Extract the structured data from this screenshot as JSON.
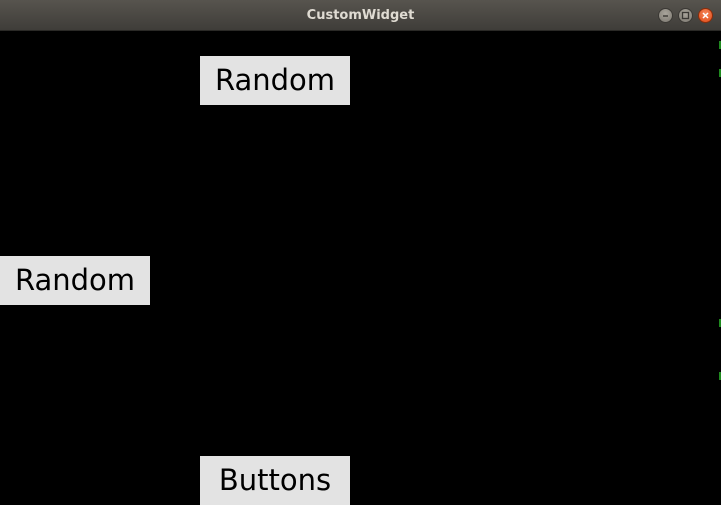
{
  "window": {
    "title": "CustomWidget"
  },
  "controls": {
    "minimize": "minimize-icon",
    "maximize": "maximize-icon",
    "close": "close-icon"
  },
  "buttons": [
    {
      "label": "Random"
    },
    {
      "label": "Random"
    },
    {
      "label": "Buttons"
    }
  ],
  "colors": {
    "titlebar": "#4a4844",
    "title_text": "#dfdbd2",
    "background": "#000000",
    "button_face": "#e3e3e3",
    "close_button": "#e8581f"
  }
}
